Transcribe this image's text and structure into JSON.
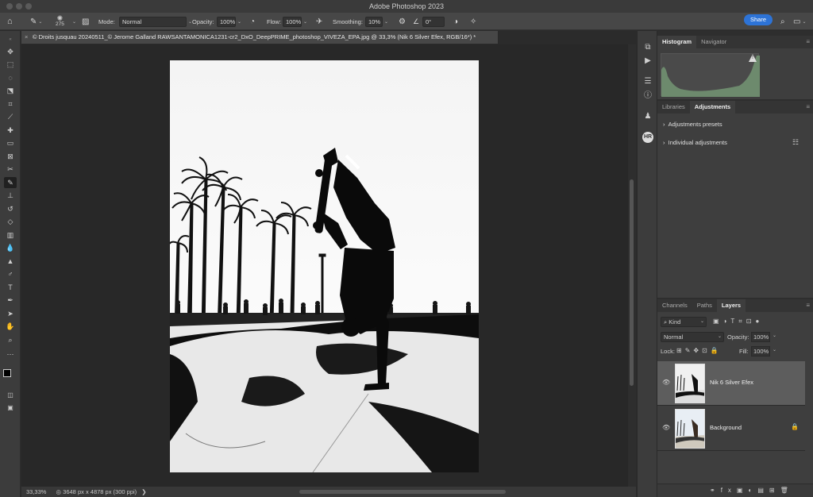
{
  "app": {
    "title": "Adobe Photoshop 2023"
  },
  "options": {
    "brush_size": "275",
    "mode_label": "Mode:",
    "mode_value": "Normal",
    "opacity_label": "Opacity:",
    "opacity_value": "100%",
    "flow_label": "Flow:",
    "flow_value": "100%",
    "smoothing_label": "Smoothing:",
    "smoothing_value": "10%",
    "angle_value": "0°",
    "share_label": "Share"
  },
  "document": {
    "tab_title": "© Droits jusquau 20240511_© Jerome Galland RAWSANTAMONICA1231-cr2_DxO_DeepPRIME_photoshop_VIVEZA_EPA.jpg @ 33,3% (Nik 6 Silver Efex, RGB/16*) *",
    "close": "×"
  },
  "status": {
    "zoom": "33,33%",
    "info": "3648 px x 4878 px (300 ppi)",
    "arrow": "❯"
  },
  "panels": {
    "histogram": {
      "tabs": [
        "Histogram",
        "Navigator"
      ],
      "warning": "!"
    },
    "adjustments": {
      "tabs": [
        "Libraries",
        "Adjustments"
      ],
      "rows": [
        "Adjustments presets",
        "Individual adjustments"
      ]
    },
    "layers": {
      "tabs": [
        "Channels",
        "Paths",
        "Layers"
      ],
      "kind_label": "Kind",
      "blend_mode": "Normal",
      "opacity_label": "Opacity:",
      "opacity_value": "100%",
      "lock_label": "Lock:",
      "fill_label": "Fill:",
      "fill_value": "100%",
      "items": [
        {
          "name": "Nik 6 Silver Efex",
          "selected": true
        },
        {
          "name": "Background",
          "locked": true
        }
      ],
      "footer_icons": [
        "link-icon",
        "fx-icon",
        "mask-icon",
        "adjustment-icon",
        "folder-icon",
        "new-layer-icon",
        "trash-icon"
      ]
    }
  },
  "colors": {
    "accent": "#2d73d6",
    "panel_bg": "#3e3e3e",
    "canvas_bg": "#282828"
  }
}
